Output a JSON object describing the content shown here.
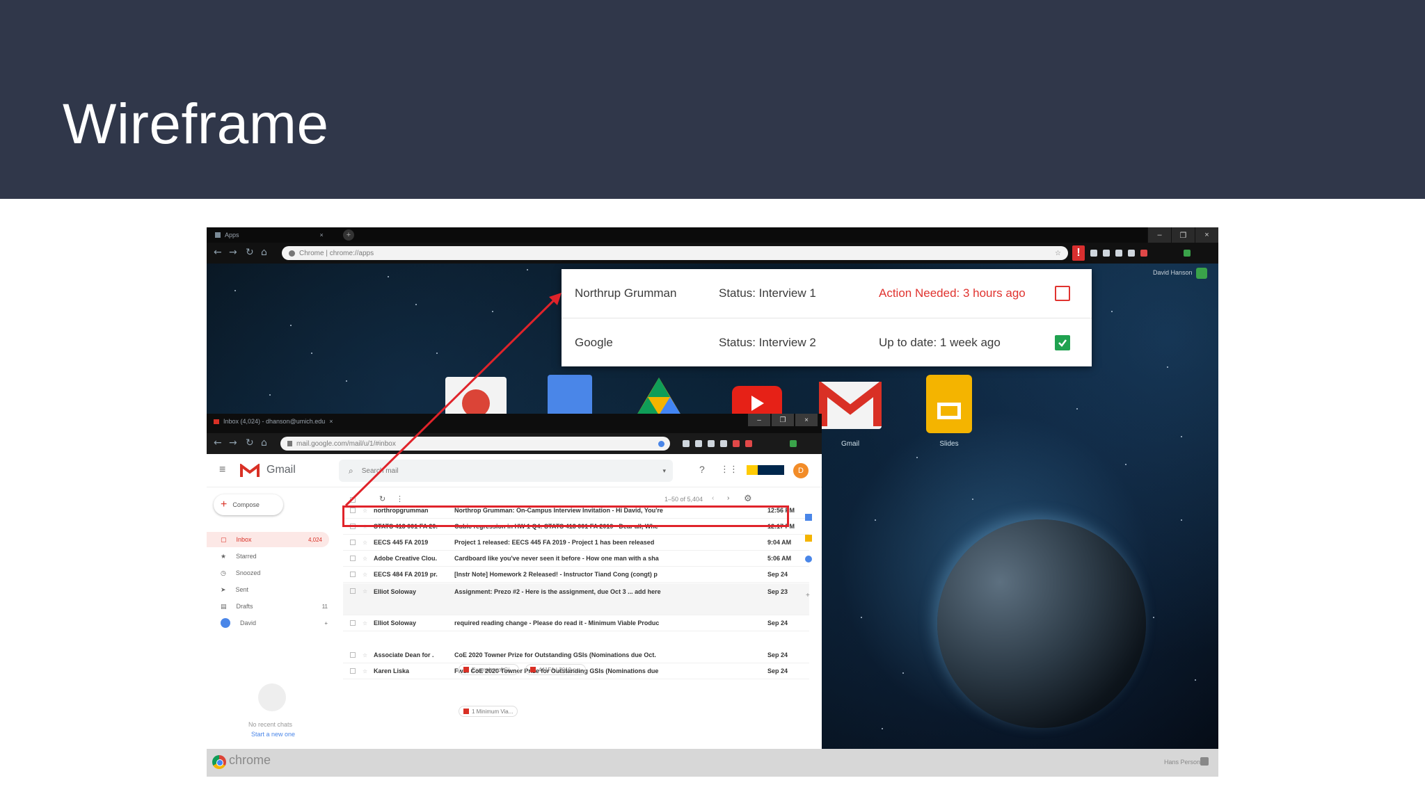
{
  "slide": {
    "title": "Wireframe"
  },
  "back_window": {
    "tab_title": "Apps",
    "omnibox": "Chrome  |  chrome://apps",
    "profile_name": "David Hanson",
    "alert_glyph": "!"
  },
  "popup": {
    "rows": [
      {
        "company": "Northrup Grumman",
        "status": "Status: Interview 1",
        "action": "Action Needed: 3 hours ago",
        "checked": false
      },
      {
        "company": "Google",
        "status": "Status: Interview 2",
        "action": "Up to date: 1 week ago",
        "checked": true
      }
    ]
  },
  "desktop_apps": [
    {
      "label": "Gmail"
    },
    {
      "label": "Slides"
    }
  ],
  "gmail": {
    "tab_title": "Inbox (4,024) - dhanson@umich.edu",
    "omnibox": "mail.google.com/mail/u/1/#inbox",
    "logo_text": "Gmail",
    "search_placeholder": "Search mail",
    "compose_label": "Compose",
    "pagination": "1–50 of 5,404",
    "avatar_initial": "D",
    "sidebar": [
      {
        "label": "Inbox",
        "count": "4,024",
        "active": true,
        "icon": "inbox-icon"
      },
      {
        "label": "Starred",
        "count": "",
        "active": false,
        "icon": "star-icon"
      },
      {
        "label": "Snoozed",
        "count": "",
        "active": false,
        "icon": "clock-icon"
      },
      {
        "label": "Sent",
        "count": "",
        "active": false,
        "icon": "send-icon"
      },
      {
        "label": "Drafts",
        "count": "11",
        "active": false,
        "icon": "draft-icon"
      },
      {
        "label": "David",
        "count": "",
        "active": false,
        "icon": "person-icon"
      }
    ],
    "hangouts_empty": "No recent chats",
    "hangouts_link": "Start a new one",
    "emails": [
      {
        "sender": "northropgrumman",
        "subject": "Northrop Grumman: On-Campus Interview Invitation - Hi David, You're",
        "date": "12:56 PM"
      },
      {
        "sender": "STATS 413 001 FA 20.",
        "subject": "Cubic regression in HW 1 Q4: STATS 413 001 FA 2019 - Dear all, Whe",
        "date": "12:17 PM"
      },
      {
        "sender": "EECS 445 FA 2019",
        "subject": "Project 1 released: EECS 445 FA 2019 - Project 1 has been released",
        "date": "9:04 AM"
      },
      {
        "sender": "Adobe Creative Clou.",
        "subject": "Cardboard like you've never seen it before - How one man with a sha",
        "date": "5:06 AM"
      },
      {
        "sender": "EECS 484 FA 2019 pr.",
        "subject": "[Instr Note] Homework 2 Released! - Instructor Tiand Cong (congt) p",
        "date": "Sep 24"
      },
      {
        "sender": "Elliot Soloway",
        "subject": "Assignment: Prezo #2 - Here is the assignment, due Oct 3 ... add here",
        "date": "Sep 23"
      },
      {
        "sender": "Elliot Soloway",
        "subject": "required reading change - Please do read it - Minimum Viable Produc",
        "date": "Sep 24"
      },
      {
        "sender": "Associate Dean for .",
        "subject": "CoE 2020 Towner Prize for Outstanding GSIs (Nominations due Oct.",
        "date": "Sep 24"
      },
      {
        "sender": "Karen Liska",
        "subject": "Fwd: CoE 2020 Towner Prize for Outstanding GSIs (Nominations due",
        "date": "Sep 24"
      }
    ],
    "attachments": [
      {
        "label": "Examples of Gi..."
      },
      {
        "label": "441FA L2019 p..."
      },
      {
        "label": "1 Minimum Via..."
      }
    ]
  },
  "taskbar": {
    "chrome_label": "chrome",
    "user": "Hans Person"
  },
  "colors": {
    "title_band": "#30374a",
    "alert_red": "#e0332f",
    "check_green": "#20a250",
    "highlight_red": "#e0232a"
  }
}
